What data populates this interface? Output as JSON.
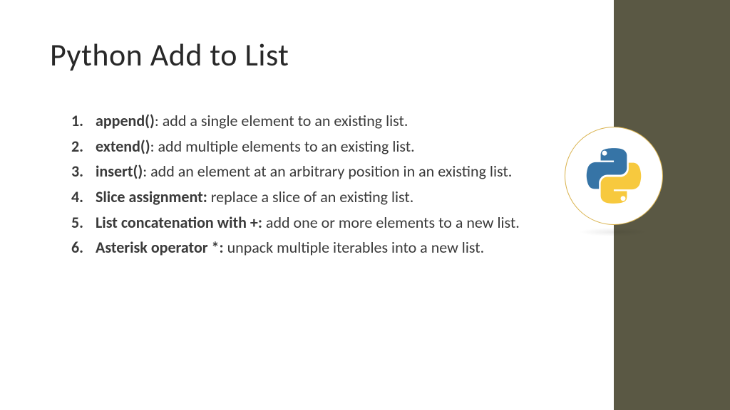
{
  "title": "Python Add to List",
  "items": [
    {
      "num": "1.",
      "bold": "append()",
      "sep": ": ",
      "desc": "add a single element to an existing list."
    },
    {
      "num": "2.",
      "bold": "extend()",
      "sep": ": ",
      "desc": "add multiple elements to an existing list."
    },
    {
      "num": "3.",
      "bold": "insert()",
      "sep": ": ",
      "desc": "add an element at an arbitrary position in an existing list."
    },
    {
      "num": "4.",
      "bold": "Slice assignment:",
      "sep": " ",
      "desc": "replace a slice of an existing list."
    },
    {
      "num": "5.",
      "bold": "List concatenation with +:",
      "sep": " ",
      "desc": "add one or more elements to a new list."
    },
    {
      "num": "6.",
      "bold": "Asterisk operator *:",
      "sep": " ",
      "desc": "unpack multiple iterables into a new list."
    }
  ],
  "logo_name": "python-logo-icon"
}
